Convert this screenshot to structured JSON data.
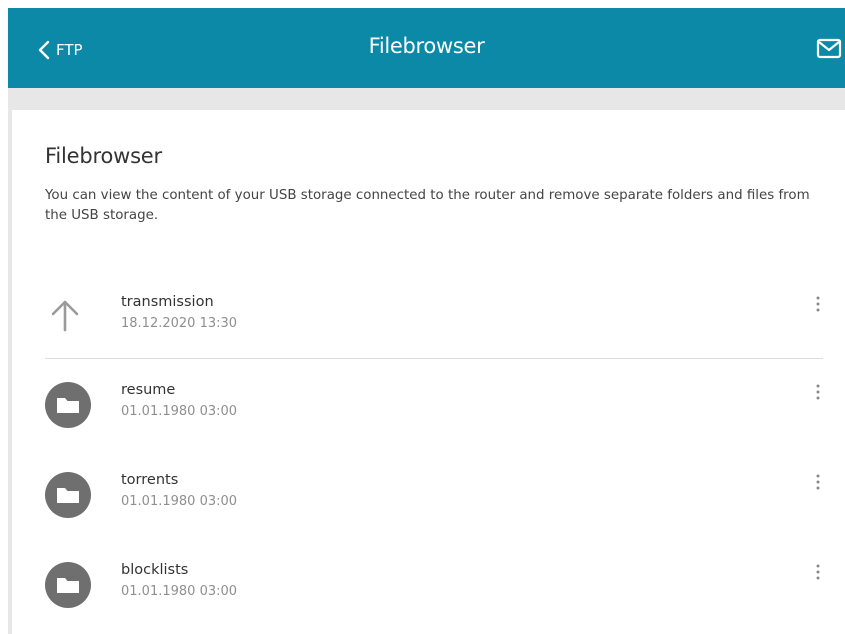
{
  "header": {
    "back_label": "FTP",
    "title": "Filebrowser",
    "icons": {
      "back": "chevron-left-icon",
      "mail": "mail-icon"
    }
  },
  "content": {
    "heading": "Filebrowser",
    "description": "You can view the content of your USB storage connected to the router and remove separate folders and files from the USB storage."
  },
  "entries": [
    {
      "name": "transmission",
      "date": "18.12.2020 13:30",
      "icon": "arrow-up-icon"
    },
    {
      "name": "resume",
      "date": "01.01.1980 03:00",
      "icon": "folder-icon"
    },
    {
      "name": "torrents",
      "date": "01.01.1980 03:00",
      "icon": "folder-icon"
    },
    {
      "name": "blocklists",
      "date": "01.01.1980 03:00",
      "icon": "folder-icon"
    }
  ],
  "colors": {
    "header_bg": "#0d89a8",
    "folder_circle": "#6f6f6f",
    "date_text": "#8f8f8f"
  }
}
